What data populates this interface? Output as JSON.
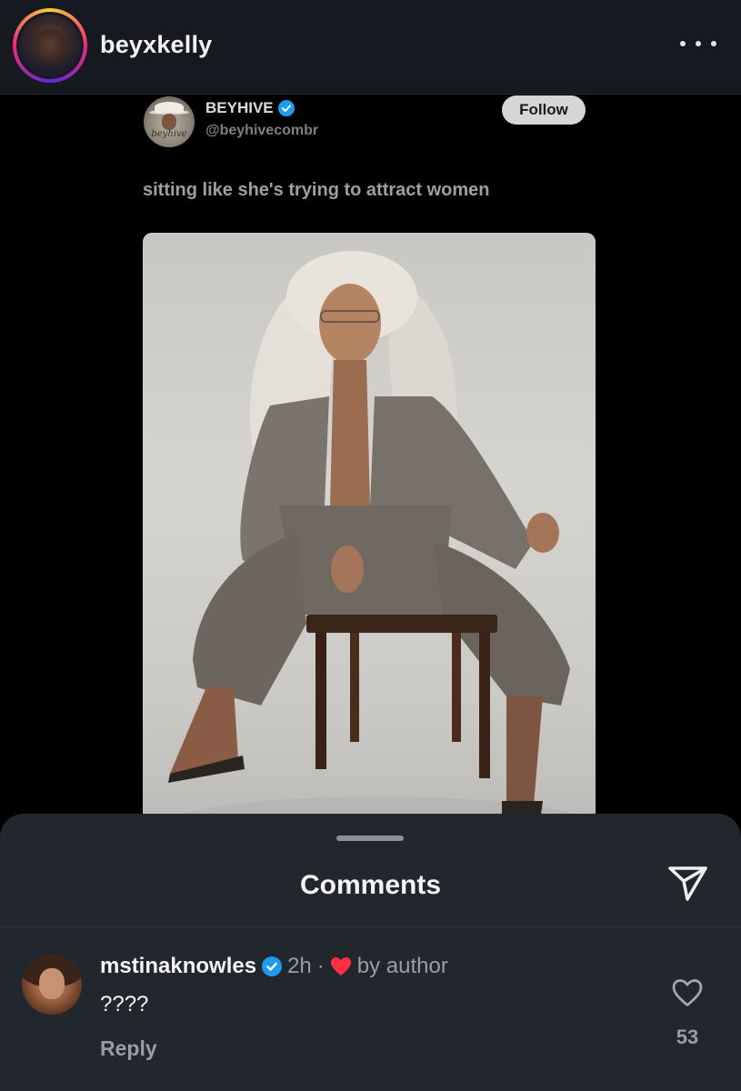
{
  "header": {
    "username": "beyxkelly",
    "more_icon": "ellipsis-horizontal-icon"
  },
  "tweet": {
    "name": "BEYHIVE",
    "handle": "@beyhivecombr",
    "avatar_text": "beyhive",
    "follow_label": "Follow",
    "text": "sitting like she's trying to attract women",
    "verified_color": "#1d9bf0"
  },
  "comments": {
    "title": "Comments",
    "send_icon": "send-icon",
    "items": [
      {
        "username": "mstinaknowles",
        "time": "2h",
        "separator": "·",
        "liked_by_author_label": "by author",
        "text": "????",
        "reply_label": "Reply",
        "like_count": "53"
      }
    ]
  },
  "colors": {
    "background": "#000000",
    "header_bg": "#16191f",
    "sheet_bg": "#22262d",
    "verified": "#1d9bf0",
    "heart_red": "#ff3040"
  }
}
